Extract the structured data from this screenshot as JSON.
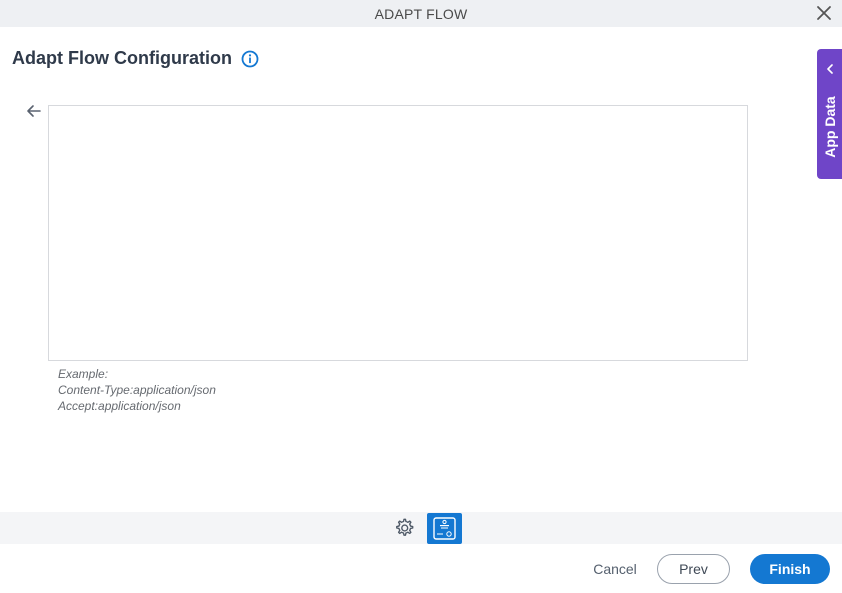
{
  "window": {
    "title": "ADAPT FLOW",
    "close_icon": "close-icon"
  },
  "header": {
    "page_title": "Adapt Flow Configuration",
    "info_icon": "info-icon"
  },
  "editor": {
    "value": "",
    "back_icon": "arrow-left-icon"
  },
  "hint": {
    "line1": "Example:",
    "line2": "Content-Type:application/json",
    "line3": "Accept:application/json"
  },
  "side_panel": {
    "label": "App Data",
    "icon": "chevron-left-icon",
    "color": "#6f45c8"
  },
  "toolbar": {
    "settings_icon": "gear-icon",
    "adapt_icon": "adapt-flow-icon",
    "accent": "#1478d2"
  },
  "footer": {
    "cancel_label": "Cancel",
    "prev_label": "Prev",
    "finish_label": "Finish"
  }
}
